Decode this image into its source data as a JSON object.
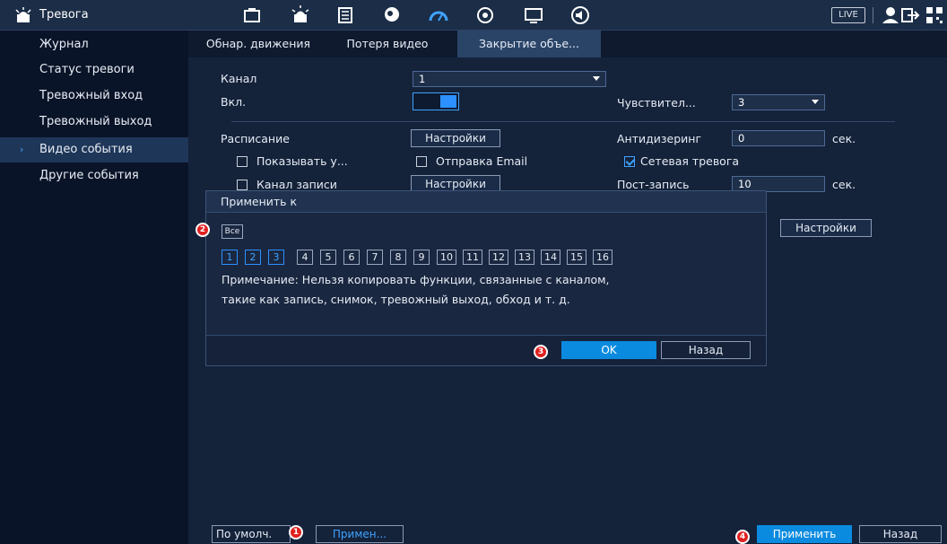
{
  "topbar": {
    "title": "Тревога",
    "live": "LIVE"
  },
  "sidebar": {
    "items": [
      {
        "label": "Журнал"
      },
      {
        "label": "Статус тревоги"
      },
      {
        "label": "Тревожный вход"
      },
      {
        "label": "Тревожный выход"
      },
      {
        "label": "Видео события"
      },
      {
        "label": "Другие события"
      }
    ]
  },
  "tabs": [
    {
      "label": "Обнар. движения"
    },
    {
      "label": "Потеря видео"
    },
    {
      "label": "Закрытие объе..."
    }
  ],
  "form": {
    "channel_label": "Канал",
    "channel_value": "1",
    "enable_label": "Вкл.",
    "sensitivity_label": "Чувствител...",
    "sensitivity_value": "3",
    "schedule_label": "Расписание",
    "schedule_button": "Настройки",
    "antidither_label": "Антидизеринг",
    "antidither_value": "0",
    "antidither_unit": "сек.",
    "show_msg_label": "Показывать у...",
    "send_email_label": "Отправка Email",
    "net_alarm_label": "Сетевая тревога",
    "record_channel_label": "Канал записи",
    "record_button": "Настройки",
    "post_record_label": "Пост-запись",
    "post_record_value": "10",
    "post_record_unit": "сек.",
    "extra_settings_button": "Настройки"
  },
  "dialog": {
    "title": "Применить к",
    "all_label": "Все",
    "channels": [
      "1",
      "2",
      "3",
      "4",
      "5",
      "6",
      "7",
      "8",
      "9",
      "10",
      "11",
      "12",
      "13",
      "14",
      "15",
      "16"
    ],
    "note_line1": "Примечание: Нельзя копировать функции, связанные с каналом,",
    "note_line2": "такие как запись, снимок, тревожный выход, обход и т. д.",
    "ok": "OK",
    "back": "Назад"
  },
  "bottom": {
    "default": "По умолч.",
    "copy": "Примен...",
    "apply": "Применить",
    "back": "Назад"
  },
  "markers": [
    "1",
    "2",
    "3",
    "4"
  ],
  "colors": {
    "accent": "#2d90ff",
    "marker": "#e02020"
  }
}
